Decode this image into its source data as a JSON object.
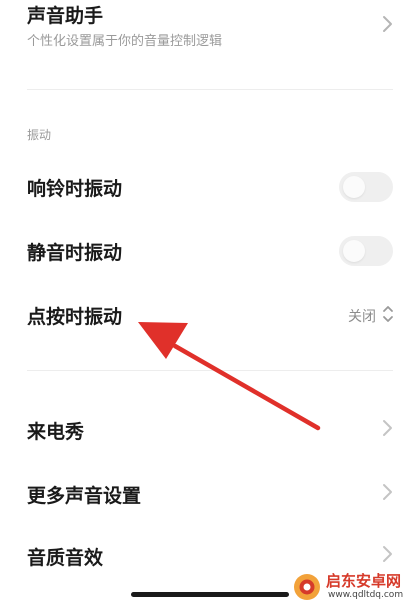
{
  "sound_assistant": {
    "title": "声音助手",
    "subtitle": "个性化设置属于你的音量控制逻辑"
  },
  "vibration_section": {
    "header": "振动",
    "ring_vibrate": {
      "label": "响铃时振动",
      "enabled": false
    },
    "silent_vibrate": {
      "label": "静音时振动",
      "enabled": false
    },
    "tap_vibrate": {
      "label": "点按时振动",
      "value": "关闭"
    }
  },
  "more_items": [
    {
      "label": "来电秀"
    },
    {
      "label": "更多声音设置"
    },
    {
      "label": "音质音效"
    }
  ],
  "annotation": {
    "arrow_color": "#e0302a"
  },
  "watermark": {
    "name": "启东安卓网",
    "url": "www.qdltdq.com"
  },
  "colors": {
    "accent": "#e0302a",
    "toggle_off": "#efefef"
  },
  "icons": [
    "chevron-right-icon",
    "up-down-chevron-icon",
    "watermark-logo-icon"
  ]
}
